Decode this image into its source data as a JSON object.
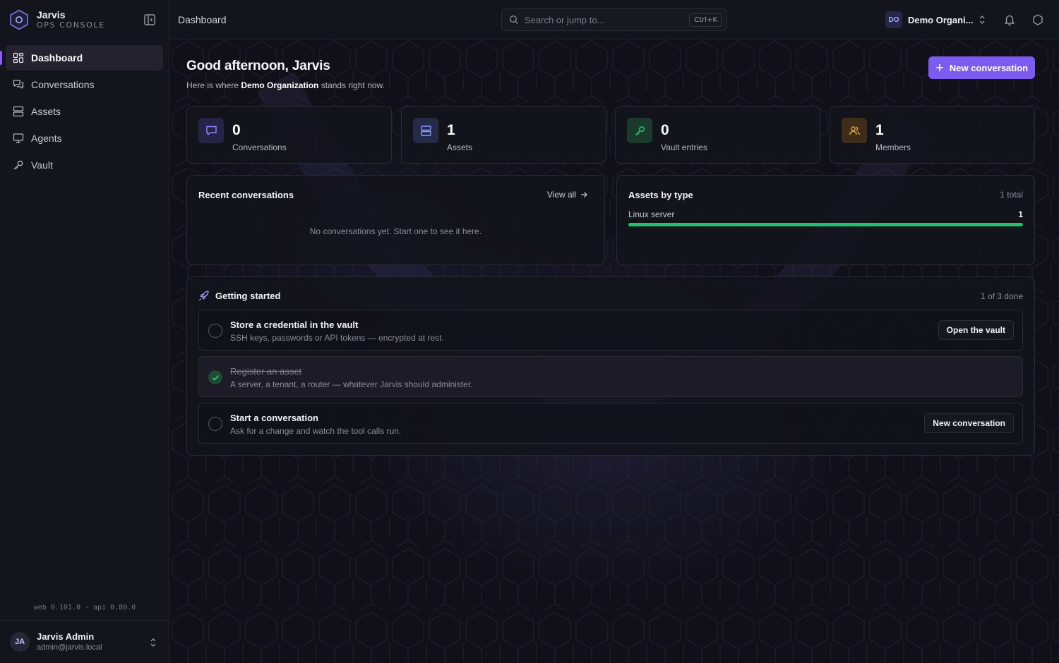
{
  "brand": {
    "name": "Jarvis",
    "subtitle": "OPS CONSOLE"
  },
  "sidebar": {
    "items": [
      {
        "label": "Dashboard",
        "icon": "dashboard-icon",
        "active": true
      },
      {
        "label": "Conversations",
        "icon": "chat-icon"
      },
      {
        "label": "Assets",
        "icon": "server-icon"
      },
      {
        "label": "Agents",
        "icon": "monitor-icon"
      },
      {
        "label": "Vault",
        "icon": "key-icon"
      }
    ],
    "version": "web 0.101.0 · api 0.80.0"
  },
  "user": {
    "initials": "JA",
    "name": "Jarvis Admin",
    "email": "admin@jarvis.local"
  },
  "topbar": {
    "breadcrumb": "Dashboard",
    "search_placeholder": "Search or jump to...",
    "search_shortcut": "Ctrl+K",
    "org_initials": "DO",
    "org_name": "Demo Organi..."
  },
  "main": {
    "greeting": "Good afternoon, Jarvis",
    "sub_prefix": "Here is where",
    "sub_org": "Demo Organization",
    "sub_suffix": "stands right now.",
    "new_button": "New conversation"
  },
  "stats": [
    {
      "value": "0",
      "label": "Conversations",
      "icon": "chat-icon",
      "color": "#8f88ff"
    },
    {
      "value": "1",
      "label": "Assets",
      "icon": "server-icon",
      "color": "#8f9cff"
    },
    {
      "value": "0",
      "label": "Vault entries",
      "icon": "key-icon",
      "color": "#32c27a"
    },
    {
      "value": "1",
      "label": "Members",
      "icon": "users-icon",
      "color": "#f0a44a"
    }
  ],
  "recent": {
    "title": "Recent conversations",
    "view_all": "View all",
    "empty": "No conversations yet. Start one to see it here."
  },
  "assets_by_type": {
    "title": "Assets by type",
    "total": "1 total",
    "rows": [
      {
        "label": "Linux server",
        "count": "1",
        "fraction": 1.0
      }
    ]
  },
  "getting_started": {
    "title": "Getting started",
    "progress": "1 of 3 done",
    "tasks": [
      {
        "title": "Store a credential in the vault",
        "desc": "SSH keys, passwords or API tokens — encrypted at rest.",
        "done": false,
        "button": "Open the vault"
      },
      {
        "title": "Register an asset",
        "desc": "A server, a tenant, a router — whatever Jarvis should administer.",
        "done": true
      },
      {
        "title": "Start a conversation",
        "desc": "Ask for a change and watch the tool calls run.",
        "done": false,
        "button": "New conversation"
      }
    ]
  },
  "colors": {
    "accent": "#7c5cf0",
    "success": "#22c073",
    "background": "#0f0f17"
  }
}
